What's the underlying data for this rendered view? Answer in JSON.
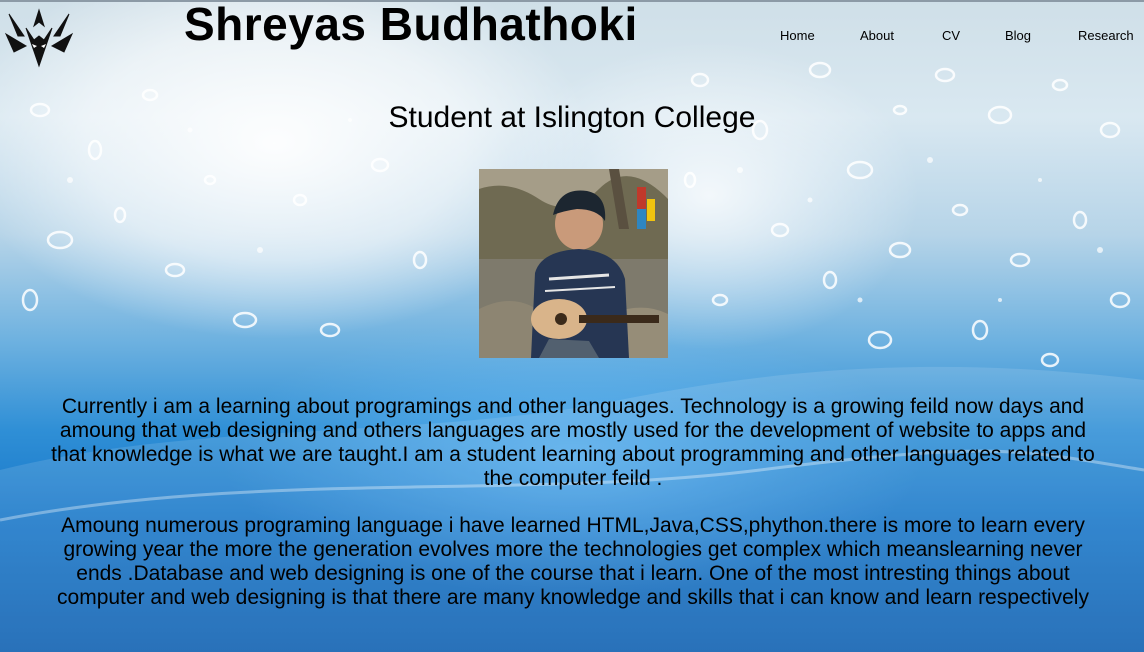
{
  "header": {
    "title": "Shreyas Budhathoki",
    "logo_icon": "dragon-logo-icon"
  },
  "nav": {
    "items": [
      {
        "label": "Home"
      },
      {
        "label": "About"
      },
      {
        "label": "CV"
      },
      {
        "label": "Blog"
      },
      {
        "label": "Research"
      }
    ]
  },
  "main": {
    "subtitle": "Student at Islington College",
    "photo_alt": "Student playing ukulele outdoors",
    "paragraphs": [
      "Currently i am a learning about programings and other languages. Technology is a growing feild now days and amoung that web designing and others languages are mostly used for the development of website to apps and that knowledge is what we are taught.I am a student learning about programming and other languages related to the computer feild .",
      "Amoung numerous programing language i have learned HTML,Java,CSS,phython.there is more to learn every growing year the more the generation evolves more the technologies get complex which meanslearning never ends .Database and web designing is one of the course that i learn. One of the most intresting things about computer and web designing is that there are many knowledge and skills that i can know and learn respectively"
    ]
  },
  "colors": {
    "water_dark": "#0c5eb0",
    "water_light": "#d9e8f1",
    "text": "#000000"
  }
}
